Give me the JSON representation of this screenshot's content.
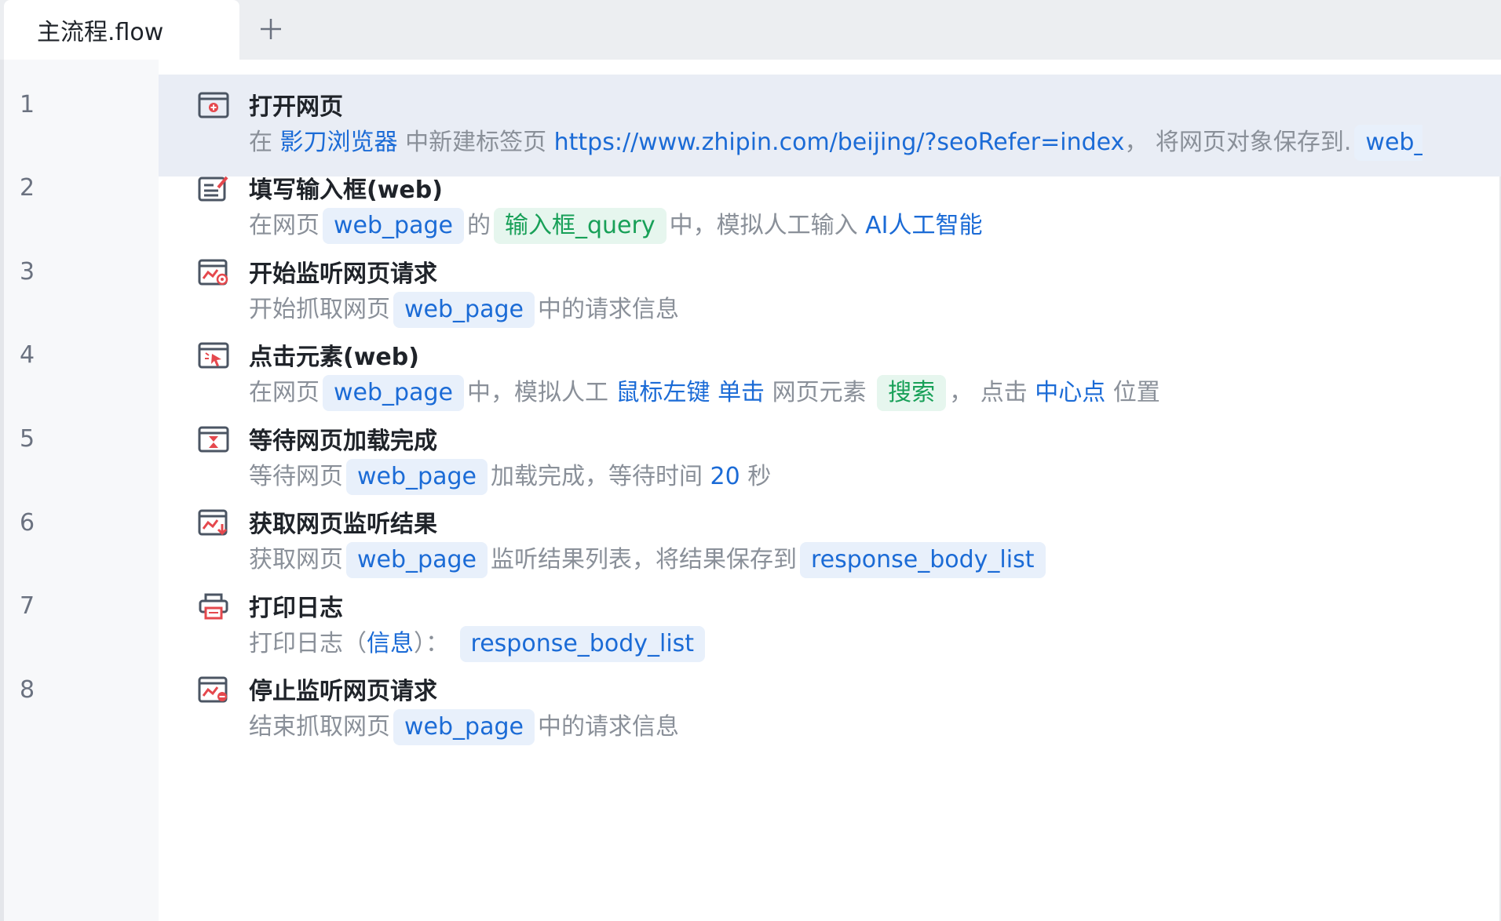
{
  "tab": {
    "title": "主流程.flow",
    "add_icon": "plus-icon"
  },
  "colors": {
    "accent": "#1b6bd6",
    "green": "#18a058",
    "muted": "#8a9099",
    "icon_red": "#e5484d"
  },
  "steps": [
    {
      "line": "1",
      "icon": "open-browser-icon",
      "title": "打开网页",
      "t1": "在",
      "browser": "影刀浏览器",
      "t2": "中新建标签页",
      "url": "https://www.zhipin.com/beijing/?seoRefer=index",
      "t3": "，  将网页对象保存到.",
      "var": "web_page"
    },
    {
      "line": "2",
      "icon": "input-form-icon",
      "title": "填写输入框(web)",
      "t1": "在网页",
      "var": "web_page",
      "t2": "的",
      "element": "输入框_query",
      "t3": "中，模拟人工输入",
      "text": "AI人工智能"
    },
    {
      "line": "3",
      "icon": "monitor-start-icon",
      "title": "开始监听网页请求",
      "t1": "开始抓取网页",
      "var": "web_page",
      "t2": "中的请求信息"
    },
    {
      "line": "4",
      "icon": "click-element-icon",
      "title": "点击元素(web)",
      "t1": "在网页",
      "var": "web_page",
      "t2": "中，模拟人工",
      "button": "鼠标左键",
      "click": "单击",
      "t3": "网页元素",
      "element": "搜索",
      "t4": "，  点击",
      "position": "中心点",
      "t5": "位置"
    },
    {
      "line": "5",
      "icon": "hourglass-icon",
      "title": "等待网页加载完成",
      "t1": "等待网页",
      "var": "web_page",
      "t2": "加载完成，等待时间",
      "seconds": "20",
      "t3": "秒"
    },
    {
      "line": "6",
      "icon": "monitor-result-icon",
      "title": "获取网页监听结果",
      "t1": "获取网页",
      "var": "web_page",
      "t2": "监听结果列表，将结果保存到",
      "result": "response_body_list"
    },
    {
      "line": "7",
      "icon": "print-icon",
      "title": "打印日志",
      "t1": "打印日志（",
      "level": "信息",
      "t2": "）：",
      "value": "response_body_list"
    },
    {
      "line": "8",
      "icon": "monitor-stop-icon",
      "title": "停止监听网页请求",
      "t1": "结束抓取网页",
      "var": "web_page",
      "t2": "中的请求信息"
    }
  ]
}
